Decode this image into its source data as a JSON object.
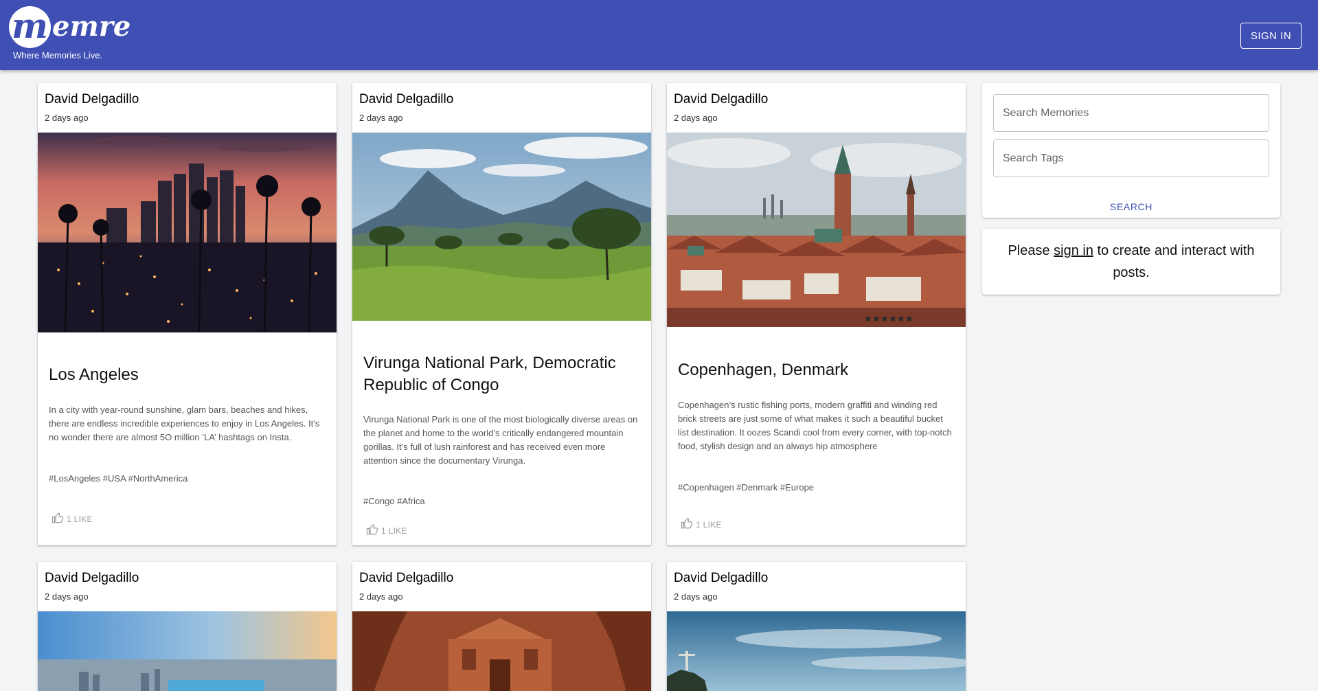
{
  "header": {
    "logo_letter": "m",
    "logo_text": "emre",
    "tagline": "Where Memories Live.",
    "signin_label": "SIGN IN",
    "color": "#3f4fb4"
  },
  "posts": [
    {
      "author": "David Delgadillo",
      "time": "2 days ago",
      "title": "Los Angeles",
      "description": "In a city with year-round sunshine, glam bars, beaches and hikes, there are endless incredible experiences to enjoy in Los Angeles. It’s no wonder there are almost 5O million ‘LA’ hashtags on Insta.",
      "tags": "#LosAngeles #USA #NorthAmerica",
      "likes": "1 LIKE",
      "image": "los-angeles-skyline"
    },
    {
      "author": "David Delgadillo",
      "time": "2 days ago",
      "title": "Virunga National Park, Democratic Republic of Congo",
      "description": "Virunga National Park is one of the most biologically diverse areas on the planet and home to the world’s critically endangered mountain gorillas. It’s full of lush rainforest and has received even more attention since the documentary Virunga.",
      "tags": "#Congo #Africa",
      "likes": "1 LIKE",
      "image": "virunga-mountains"
    },
    {
      "author": "David Delgadillo",
      "time": "2 days ago",
      "title": "Copenhagen, Denmark",
      "description": "Copenhagen’s rustic fishing ports, modern graffiti and winding red brick streets are just some of what makes it such a beautiful bucket list destination. It oozes Scandi cool from every corner, with top-notch food, stylish design and an always hip atmosphere",
      "tags": "#Copenhagen #Denmark #Europe",
      "likes": "1 LIKE",
      "image": "copenhagen-rooftops"
    },
    {
      "author": "David Delgadillo",
      "time": "2 days ago",
      "image": "city-river-sunset"
    },
    {
      "author": "David Delgadillo",
      "time": "2 days ago",
      "image": "petra-monastery"
    },
    {
      "author": "David Delgadillo",
      "time": "2 days ago",
      "image": "rio-christ-redeemer"
    }
  ],
  "search": {
    "memories_placeholder": "Search Memories",
    "tags_placeholder": "Search Tags",
    "button_label": "SEARCH"
  },
  "signin_prompt": {
    "before": "Please",
    "link": "sign in",
    "after": "to create and interact with posts."
  },
  "icons": {
    "like": "thumb-up-outline-icon"
  }
}
